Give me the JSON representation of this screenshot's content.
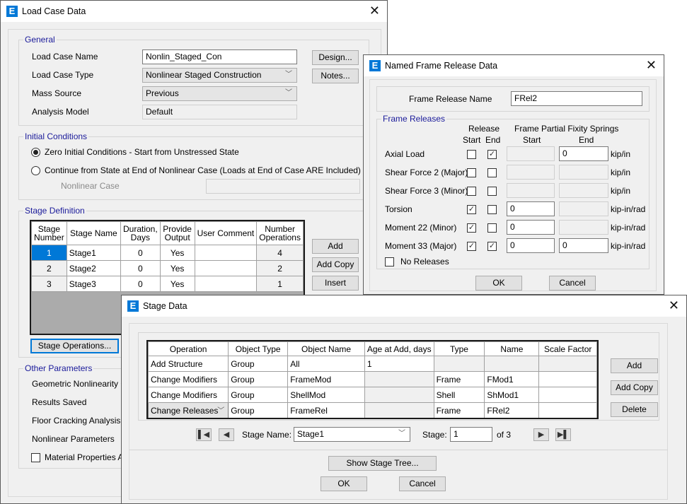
{
  "load_case": {
    "title": "Load Case Data",
    "general": {
      "label": "General",
      "name_label": "Load Case Name",
      "name_value": "Nonlin_Staged_Con",
      "type_label": "Load Case Type",
      "type_value": "Nonlinear Staged Construction",
      "mass_label": "Mass Source",
      "mass_value": "Previous",
      "model_label": "Analysis Model",
      "model_value": "Default",
      "design_button": "Design...",
      "notes_button": "Notes..."
    },
    "initial": {
      "label": "Initial Conditions",
      "option_zero": "Zero Initial Conditions - Start from Unstressed State",
      "option_continue": "Continue from State at End of Nonlinear Case  (Loads at End of Case ARE Included)",
      "nonlinear_case_label": "Nonlinear Case",
      "nonlinear_case_value": ""
    },
    "stage_def": {
      "label": "Stage Definition",
      "headers": [
        "Stage\nNumber",
        "Stage Name",
        "Duration,\nDays",
        "Provide\nOutput",
        "User Comment",
        "Number\nOperations"
      ],
      "header_lines": [
        [
          "Stage",
          "Number"
        ],
        [
          "Stage Name"
        ],
        [
          "Duration,",
          "Days"
        ],
        [
          "Provide",
          "Output"
        ],
        [
          "User Comment"
        ],
        [
          "Number",
          "Operations"
        ]
      ],
      "rows": [
        {
          "number": "1",
          "name": "Stage1",
          "duration": "0",
          "output": "Yes",
          "comment": "",
          "ops": "4"
        },
        {
          "number": "2",
          "name": "Stage2",
          "duration": "0",
          "output": "Yes",
          "comment": "",
          "ops": "2"
        },
        {
          "number": "3",
          "name": "Stage3",
          "duration": "0",
          "output": "Yes",
          "comment": "",
          "ops": "1"
        }
      ],
      "add_button": "Add",
      "add_copy_button": "Add Copy",
      "insert_button": "Insert",
      "stage_ops_button": "Stage Operations..."
    },
    "other": {
      "label": "Other Parameters",
      "geometric": "Geometric Nonlinearity Opti",
      "results_saved": "Results Saved",
      "floor_cracking": "Floor Cracking Analysis",
      "nonlinear_params": "Nonlinear Parameters",
      "material_props": "Material Properties Are"
    }
  },
  "frame_release": {
    "title": "Named Frame Release Data",
    "name_label": "Frame Release Name",
    "name_value": "FRel2",
    "group_label": "Frame Releases",
    "release_header": "Release",
    "start_header": "Start",
    "end_header": "End",
    "springs_header": "Frame Partial Fixity Springs",
    "springs_start": "Start",
    "springs_end": "End",
    "rows": [
      {
        "label": "Axial Load",
        "start": false,
        "end": true,
        "spring_start": null,
        "spring_end": "0",
        "unit": "kip/in"
      },
      {
        "label": "Shear Force 2 (Major)",
        "start": false,
        "end": false,
        "spring_start": null,
        "spring_end": null,
        "unit": "kip/in"
      },
      {
        "label": "Shear Force 3 (Minor)",
        "start": false,
        "end": false,
        "spring_start": null,
        "spring_end": null,
        "unit": "kip/in"
      },
      {
        "label": "Torsion",
        "start": true,
        "end": false,
        "spring_start": "0",
        "spring_end": null,
        "unit": "kip-in/rad"
      },
      {
        "label": "Moment 22 (Minor)",
        "start": true,
        "end": false,
        "spring_start": "0",
        "spring_end": null,
        "unit": "kip-in/rad"
      },
      {
        "label": "Moment 33 (Major)",
        "start": true,
        "end": true,
        "spring_start": "0",
        "spring_end": "0",
        "unit": "kip-in/rad"
      }
    ],
    "no_releases_label": "No Releases",
    "no_releases_checked": false,
    "ok_button": "OK",
    "cancel_button": "Cancel"
  },
  "stage_data": {
    "title": "Stage Data",
    "headers": [
      "Operation",
      "Object Type",
      "Object Name",
      "Age at Add, days",
      "Type",
      "Name",
      "Scale Factor"
    ],
    "rows": [
      {
        "operation": "Add Structure",
        "object_type": "Group",
        "object_name": "All",
        "age": "1",
        "type": "",
        "name": "",
        "scale": ""
      },
      {
        "operation": "Change Modifiers",
        "object_type": "Group",
        "object_name": "FrameMod",
        "age": "",
        "type": "Frame",
        "name": "FMod1",
        "scale": ""
      },
      {
        "operation": "Change Modifiers",
        "object_type": "Group",
        "object_name": "ShellMod",
        "age": "",
        "type": "Shell",
        "name": "ShMod1",
        "scale": ""
      },
      {
        "operation": "Change Releases",
        "object_type": "Group",
        "object_name": "FrameRel",
        "age": "",
        "type": "Frame",
        "name": "FRel2",
        "scale": ""
      }
    ],
    "add_button": "Add",
    "add_copy_button": "Add Copy",
    "delete_button": "Delete",
    "stage_name_label": "Stage Name:",
    "stage_name_value": "Stage1",
    "stage_label": "Stage:",
    "stage_value": "1",
    "stage_of": "of 3",
    "show_tree_button": "Show Stage Tree...",
    "ok_button": "OK",
    "cancel_button": "Cancel"
  },
  "icons": {
    "app": "E",
    "close": "✕",
    "chevron": "﹀",
    "check": "✓"
  }
}
